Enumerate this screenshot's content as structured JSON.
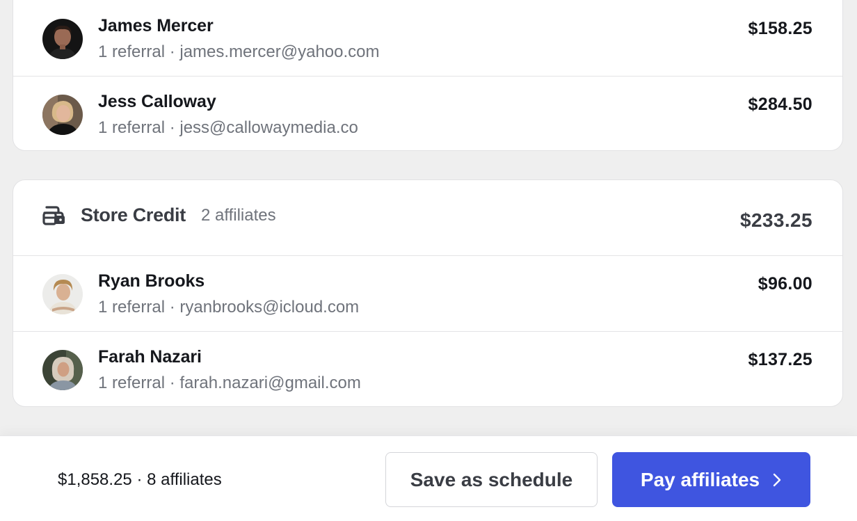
{
  "top_group": {
    "affiliates": [
      {
        "name": "James Mercer",
        "referrals": "1 referral",
        "email": "james.mercer@yahoo.com",
        "amount": "$158.25"
      },
      {
        "name": "Jess Calloway",
        "referrals": "1 referral",
        "email": "jess@callowaymedia.co",
        "amount": "$284.50"
      }
    ]
  },
  "store_credit": {
    "icon": "wallet-card-icon",
    "title": "Store Credit",
    "count": "2 affiliates",
    "total": "$233.25",
    "affiliates": [
      {
        "name": "Ryan Brooks",
        "referrals": "1 referral",
        "email": "ryanbrooks@icloud.com",
        "amount": "$96.00"
      },
      {
        "name": "Farah Nazari",
        "referrals": "1 referral",
        "email": "farah.nazari@gmail.com",
        "amount": "$137.25"
      }
    ]
  },
  "separator": " · ",
  "footer": {
    "total": "$1,858.25",
    "count": "8 affiliates",
    "save_label": "Save as schedule",
    "pay_label": "Pay affiliates",
    "pay_icon": "chevron-right-icon"
  },
  "colors": {
    "primary": "#3f55e0",
    "background": "#efefef",
    "muted_text": "#6f737b"
  }
}
